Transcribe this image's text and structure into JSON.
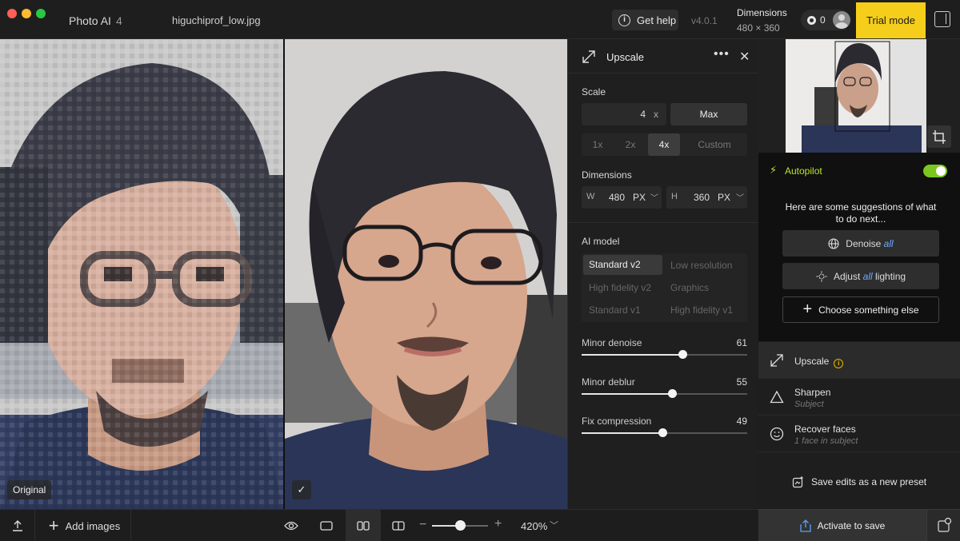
{
  "titlebar": {
    "app_name": "Photo AI",
    "app_version_badge": "4",
    "file_name": "higuchiprof_low.jpg",
    "help_label": "Get help",
    "version": "v4.0.1",
    "dimensions_label": "Dimensions",
    "dimensions_value": "480 × 360",
    "credits": "0",
    "trial_label": "Trial mode"
  },
  "image_view": {
    "original_tag": "Original",
    "processed_tag": "✓"
  },
  "bottombar": {
    "add_images_label": "Add images",
    "zoom_value": "420%",
    "zoom_level": 0.5
  },
  "upscale": {
    "title": "Upscale",
    "scale_label": "Scale",
    "scale_value": "4",
    "scale_unit": "x",
    "max_label": "Max",
    "scale_options": [
      "1x",
      "2x",
      "4x",
      "Custom"
    ],
    "scale_selected": "4x",
    "dimensions_label": "Dimensions",
    "width_label": "W",
    "width_value": "480",
    "height_label": "H",
    "height_value": "360",
    "unit": "PX",
    "ai_model_label": "AI model",
    "models": [
      "Standard v2",
      "Low resolution",
      "High fidelity v2",
      "Graphics",
      "Standard v1",
      "High fidelity v1"
    ],
    "model_selected": "Standard v2",
    "sliders": [
      {
        "name": "Minor denoise",
        "value": 61
      },
      {
        "name": "Minor deblur",
        "value": 55
      },
      {
        "name": "Fix compression",
        "value": 49
      }
    ]
  },
  "autopilot": {
    "title": "Autopilot",
    "suggest_text": "Here are some suggestions of what to do next...",
    "denoise_label": "Denoise",
    "denoise_em": "all",
    "adjust_label": "Adjust",
    "adjust_em": "all",
    "adjust_suffix": "lighting",
    "choose_label": "Choose something else"
  },
  "operations": [
    {
      "title": "Upscale",
      "subtitle": ""
    },
    {
      "title": "Sharpen",
      "subtitle": "Subject"
    },
    {
      "title": "Recover faces",
      "subtitle": "1 face in subject"
    }
  ],
  "save_preset_label": "Save edits as a new preset",
  "activate_label": "Activate to save",
  "colors": {
    "accent_yellow": "#f5ce1b",
    "autopilot_green": "#b8e62a",
    "link_blue": "#6ea8ff"
  }
}
